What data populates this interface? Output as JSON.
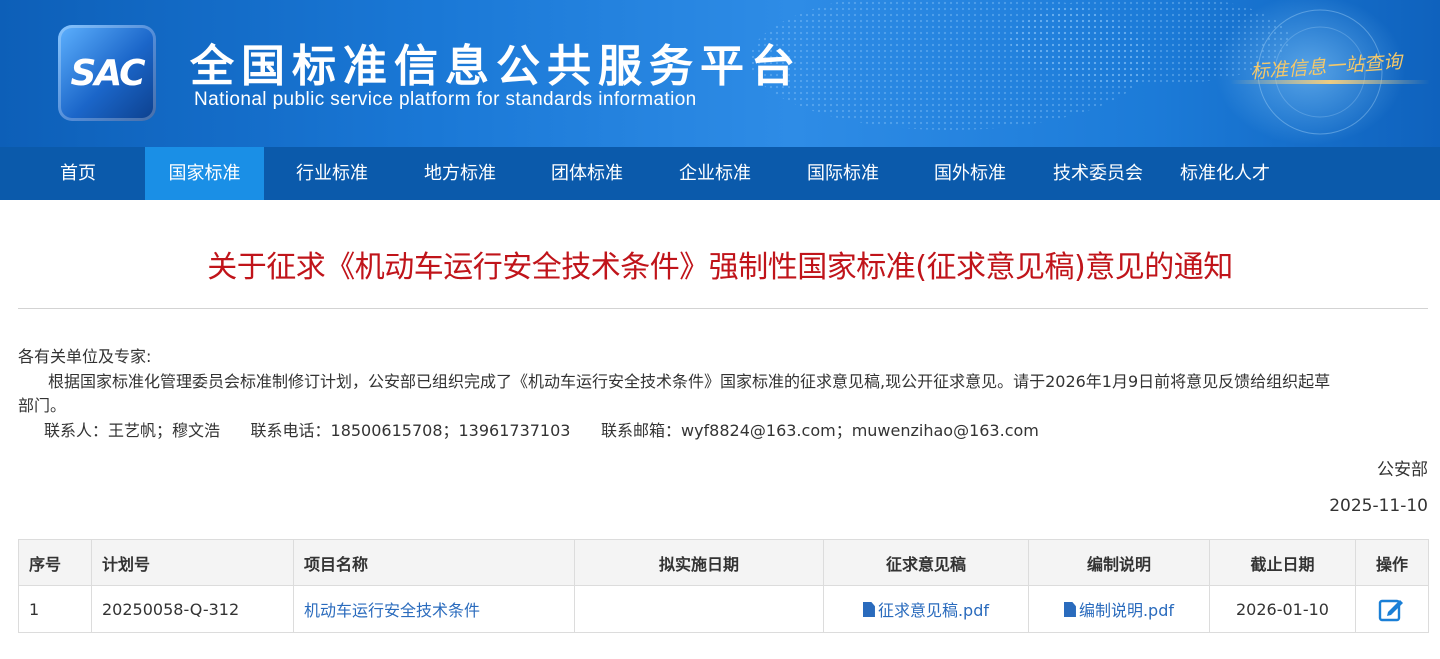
{
  "header": {
    "logo_text": "SAC",
    "title": "全国标准信息公共服务平台",
    "subtitle": "National public service platform  for standards information",
    "slogan": "标准信息一站查询"
  },
  "nav": {
    "items": [
      {
        "label": "首页"
      },
      {
        "label": "国家标准"
      },
      {
        "label": "行业标准"
      },
      {
        "label": "地方标准"
      },
      {
        "label": "团体标准"
      },
      {
        "label": "企业标准"
      },
      {
        "label": "国际标准"
      },
      {
        "label": "国外标准"
      },
      {
        "label": "技术委员会"
      },
      {
        "label": "标准化人才"
      }
    ],
    "active_item": "国家标准"
  },
  "article": {
    "title": "关于征求《机动车运行安全技术条件》强制性国家标准(征求意见稿)意见的通知",
    "greeting": "各有关单位及专家:",
    "paragraph_line1": "根据国家标准化管理委员会标准制修订计划，公安部已组织完成了《机动车运行安全技术条件》国家标准的征求意见稿,现公开征求意见。请于2026年1月9日前将意见反馈给组织起草",
    "paragraph_line2": "部门。",
    "contact_line": "联系人：王艺帆；穆文浩      联系电话：18500615708；13961737103      联系邮箱：wyf8824@163.com；muwenzihao@163.com",
    "issuer": "公安部",
    "date": "2025-11-10"
  },
  "table": {
    "headers": [
      "序号",
      "计划号",
      "项目名称",
      "拟实施日期",
      "征求意见稿",
      "编制说明",
      "截止日期",
      "操作"
    ],
    "rows": [
      {
        "index": "1",
        "plan_no": "20250058-Q-312",
        "project_name": "机动车运行安全技术条件",
        "implement_date": "",
        "draft_file": "征求意见稿.pdf",
        "explanation_file": "编制说明.pdf",
        "deadline": "2026-01-10",
        "action_icon": "edit-feedback-icon"
      }
    ]
  },
  "colors": {
    "banner": "#1a78d6",
    "nav": "#0b5aab",
    "nav_active": "#1a8fe6",
    "title_red": "#c0141a",
    "link_blue": "#2a6bbd"
  }
}
